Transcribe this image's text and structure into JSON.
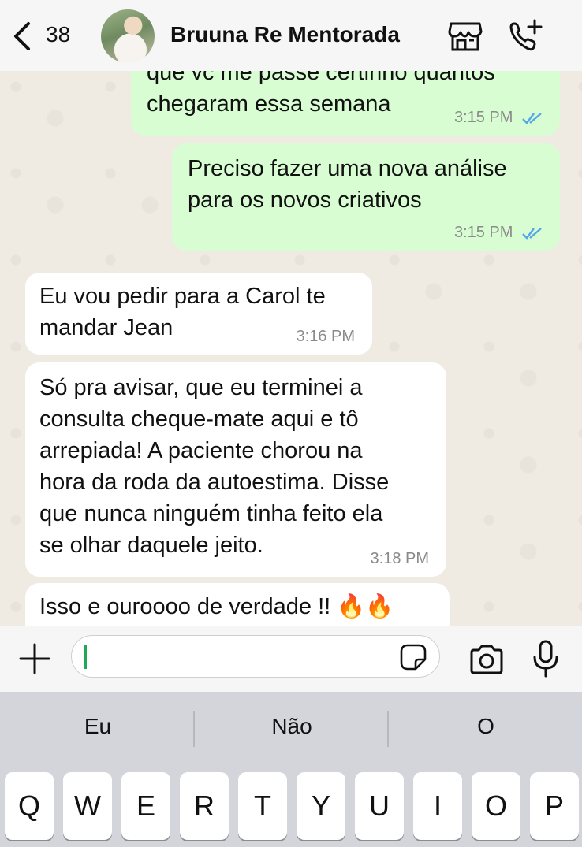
{
  "header": {
    "back_count": "38",
    "contact_name": "Bruuna Re Mentorada"
  },
  "messages": [
    {
      "direction": "out",
      "text": "que vc me passe certinho quantos\nchegaram essa semana",
      "time": "3:15 PM",
      "read": true
    },
    {
      "direction": "out",
      "text": "Preciso fazer uma nova análise\npara os novos criativos",
      "time": "3:15 PM",
      "read": true
    },
    {
      "direction": "in",
      "text": "Eu vou pedir para a Carol te\nmandar Jean",
      "time": "3:16 PM"
    },
    {
      "direction": "in",
      "text": "Só pra avisar, que eu  terminei a\nconsulta cheque-mate aqui e tô\narrepiada! A paciente chorou na\nhora da roda da autoestima. Disse\nque nunca ninguém tinha feito ela\nse olhar daquele jeito.",
      "time": "3:18 PM"
    },
    {
      "direction": "in",
      "text": "Isso e ouroooo de verdade !! 🔥🔥",
      "time": ""
    }
  ],
  "input": {
    "value": ""
  },
  "keyboard": {
    "suggestions": [
      "Eu",
      "Não",
      "O"
    ],
    "keys": [
      "Q",
      "W",
      "E",
      "R",
      "T",
      "Y",
      "U",
      "I",
      "O",
      "P"
    ]
  },
  "colors": {
    "outgoing_bubble": "#d9fdd3",
    "incoming_bubble": "#ffffff",
    "chat_background": "#efeae2",
    "read_ticks": "#53a6e8",
    "caret": "#1fa855"
  },
  "icons": [
    "chevron-left-icon",
    "store-icon",
    "phone-add-icon",
    "plus-icon",
    "sticker-icon",
    "camera-icon",
    "microphone-icon",
    "double-check-icon"
  ]
}
